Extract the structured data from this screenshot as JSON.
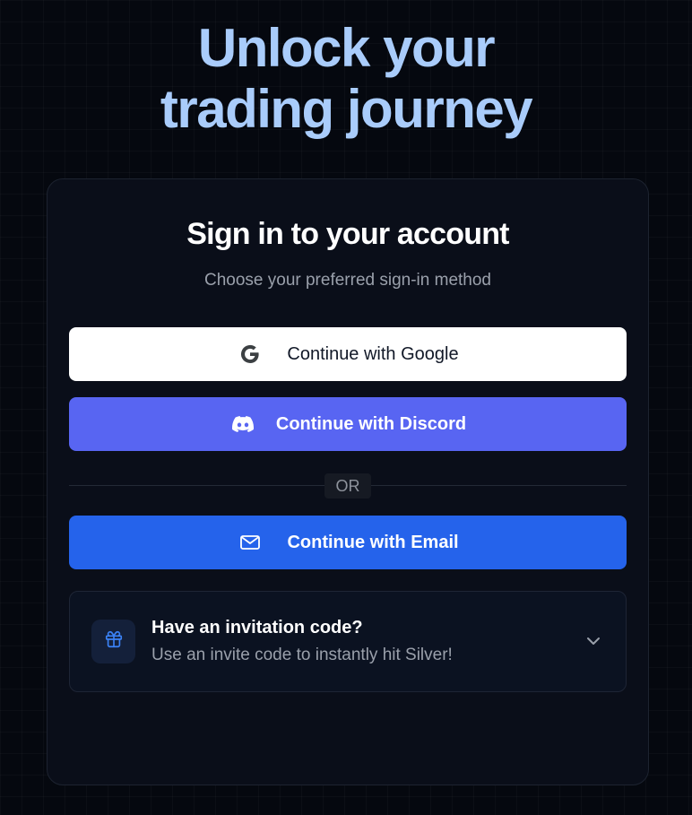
{
  "hero": {
    "line1": "Unlock your",
    "line2": "trading journey"
  },
  "card": {
    "title": "Sign in to your account",
    "subtitle": "Choose your preferred sign-in method"
  },
  "buttons": {
    "google": {
      "label": "Continue with Google",
      "icon": "google-icon"
    },
    "discord": {
      "label": "Continue with Discord",
      "icon": "discord-icon"
    },
    "email": {
      "label": "Continue with Email",
      "icon": "mail-icon"
    }
  },
  "divider": {
    "label": "OR"
  },
  "invite": {
    "title": "Have an invitation code?",
    "subtitle": "Use an invite code to instantly hit Silver!",
    "icon": "gift-icon",
    "toggle_icon": "chevron-down-icon"
  },
  "colors": {
    "background": "#05080f",
    "hero_text": "#a9ccfb",
    "card": "#0a0e19",
    "discord": "#5865f2",
    "email": "#2563eb"
  }
}
